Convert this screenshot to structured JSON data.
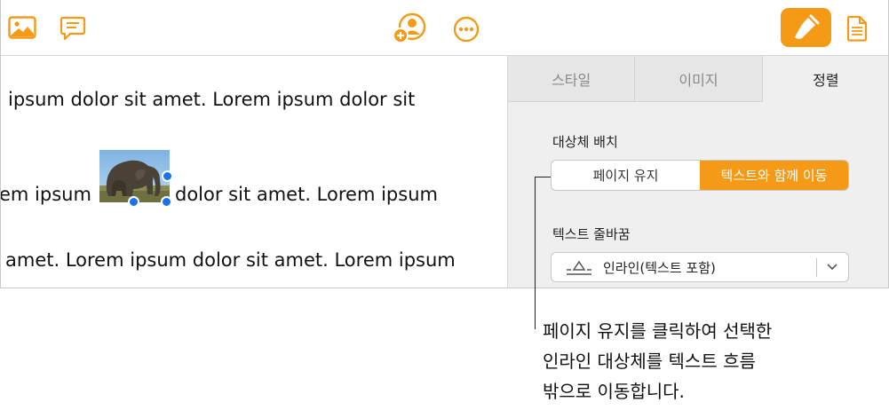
{
  "toolbar": {
    "left_icons": [
      "photo-icon",
      "comment-icon"
    ],
    "center_icons": [
      "collaborate-icon",
      "more-icon"
    ],
    "right_icons": [
      "format-brush-icon",
      "document-icon"
    ],
    "accent": "#f59a17"
  },
  "document": {
    "line1": "ipsum dolor sit amet.  Lorem ipsum dolor sit",
    "line2_before": "em ipsum",
    "line2_after": "dolor sit amet. Lorem ipsum",
    "line3": "amet. Lorem ipsum dolor sit amet. Lorem ipsum"
  },
  "sidebar": {
    "tabs": [
      {
        "label": "스타일"
      },
      {
        "label": "이미지"
      },
      {
        "label": "정렬"
      }
    ],
    "object_placement": {
      "label": "대상체 배치",
      "options": [
        "페이지 유지",
        "텍스트와 함께 이동"
      ]
    },
    "text_wrap": {
      "label": "텍스트 줄바꿈",
      "value": "인라인(텍스트 포함)"
    }
  },
  "callout": {
    "lines": [
      "페이지 유지를 클릭하여 선택한",
      "인라인 대상체를 텍스트 흐름",
      "밖으로 이동합니다."
    ]
  }
}
